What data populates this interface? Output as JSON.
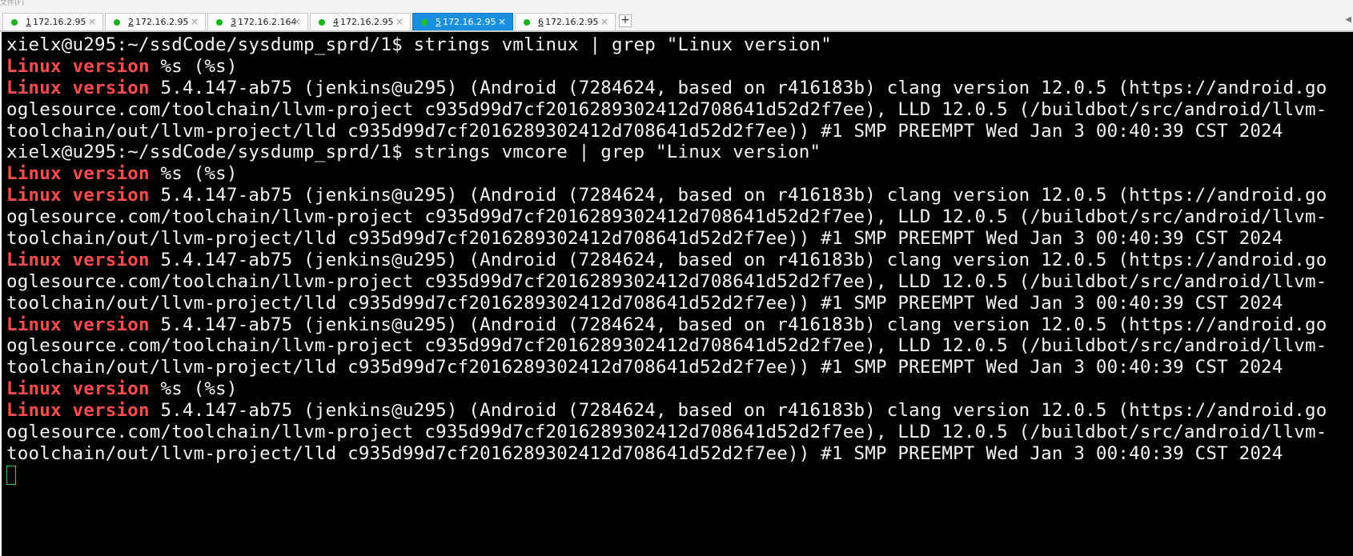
{
  "window": {
    "title_fragment": "文件(F)"
  },
  "tabs": [
    {
      "number": "1",
      "host": "172.16.2.95",
      "dot_color": "#18b418",
      "active": false
    },
    {
      "number": "2",
      "host": "172.16.2.95",
      "dot_color": "#18b418",
      "active": false
    },
    {
      "number": "3",
      "host": "172.16.2.164",
      "dot_color": "#18b418",
      "active": false
    },
    {
      "number": "4",
      "host": "172.16.2.95",
      "dot_color": "#18b418",
      "active": false
    },
    {
      "number": "5",
      "host": "172.16.2.95",
      "dot_color": "#1fc01f",
      "active": true
    },
    {
      "number": "6",
      "host": "172.16.2.95",
      "dot_color": "#18b418",
      "active": false
    }
  ],
  "tab_close_glyph": "×",
  "add_tab_glyph": "+",
  "scroll_left_glyph": "◀",
  "colors": {
    "terminal_bg": "#000000",
    "terminal_fg": "#f4f4f4",
    "keyword": "#ff4d4d",
    "cursor": "#25d84a",
    "active_tab": "#1a8fe0"
  },
  "terminal": {
    "lines": [
      {
        "kw": "",
        "text": "xielx@u295:~/ssdCode/sysdump_sprd/1$ strings vmlinux | grep \"Linux version\""
      },
      {
        "kw": "Linux version",
        "text": " %s (%s)"
      },
      {
        "kw": "Linux version",
        "text": " 5.4.147-ab75 (jenkins@u295) (Android (7284624, based on r416183b) clang version 12.0.5 (https://android.go"
      },
      {
        "kw": "",
        "text": "oglesource.com/toolchain/llvm-project c935d99d7cf2016289302412d708641d52d2f7ee), LLD 12.0.5 (/buildbot/src/android/llvm-"
      },
      {
        "kw": "",
        "text": "toolchain/out/llvm-project/lld c935d99d7cf2016289302412d708641d52d2f7ee)) #1 SMP PREEMPT Wed Jan 3 00:40:39 CST 2024"
      },
      {
        "kw": "",
        "text": "xielx@u295:~/ssdCode/sysdump_sprd/1$ strings vmcore | grep \"Linux version\""
      },
      {
        "kw": "Linux version",
        "text": " %s (%s)"
      },
      {
        "kw": "Linux version",
        "text": " 5.4.147-ab75 (jenkins@u295) (Android (7284624, based on r416183b) clang version 12.0.5 (https://android.go"
      },
      {
        "kw": "",
        "text": "oglesource.com/toolchain/llvm-project c935d99d7cf2016289302412d708641d52d2f7ee), LLD 12.0.5 (/buildbot/src/android/llvm-"
      },
      {
        "kw": "",
        "text": "toolchain/out/llvm-project/lld c935d99d7cf2016289302412d708641d52d2f7ee)) #1 SMP PREEMPT Wed Jan 3 00:40:39 CST 2024"
      },
      {
        "kw": "Linux version",
        "text": " 5.4.147-ab75 (jenkins@u295) (Android (7284624, based on r416183b) clang version 12.0.5 (https://android.go"
      },
      {
        "kw": "",
        "text": "oglesource.com/toolchain/llvm-project c935d99d7cf2016289302412d708641d52d2f7ee), LLD 12.0.5 (/buildbot/src/android/llvm-"
      },
      {
        "kw": "",
        "text": "toolchain/out/llvm-project/lld c935d99d7cf2016289302412d708641d52d2f7ee)) #1 SMP PREEMPT Wed Jan 3 00:40:39 CST 2024"
      },
      {
        "kw": "Linux version",
        "text": " 5.4.147-ab75 (jenkins@u295) (Android (7284624, based on r416183b) clang version 12.0.5 (https://android.go"
      },
      {
        "kw": "",
        "text": "oglesource.com/toolchain/llvm-project c935d99d7cf2016289302412d708641d52d2f7ee), LLD 12.0.5 (/buildbot/src/android/llvm-"
      },
      {
        "kw": "",
        "text": "toolchain/out/llvm-project/lld c935d99d7cf2016289302412d708641d52d2f7ee)) #1 SMP PREEMPT Wed Jan 3 00:40:39 CST 2024"
      },
      {
        "kw": "Linux version",
        "text": " %s (%s)"
      },
      {
        "kw": "Linux version",
        "text": " 5.4.147-ab75 (jenkins@u295) (Android (7284624, based on r416183b) clang version 12.0.5 (https://android.go"
      },
      {
        "kw": "",
        "text": "oglesource.com/toolchain/llvm-project c935d99d7cf2016289302412d708641d52d2f7ee), LLD 12.0.5 (/buildbot/src/android/llvm-"
      },
      {
        "kw": "",
        "text": "toolchain/out/llvm-project/lld c935d99d7cf2016289302412d708641d52d2f7ee)) #1 SMP PREEMPT Wed Jan 3 00:40:39 CST 2024"
      }
    ]
  }
}
